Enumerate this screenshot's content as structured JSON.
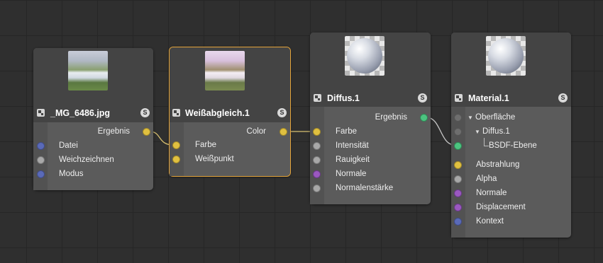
{
  "nodes": {
    "image": {
      "title": "_MG_6486.jpg",
      "badge": "S",
      "output": "Ergebnis",
      "inputs": [
        "Datei",
        "Weichzeichnen",
        "Modus"
      ]
    },
    "whitebalance": {
      "title": "Weißabgleich.1",
      "badge": "S",
      "output": "Color",
      "inputs": [
        "Farbe",
        "Weißpunkt"
      ]
    },
    "diffuse": {
      "title": "Diffus.1",
      "badge": "S",
      "output": "Ergebnis",
      "inputs": [
        "Farbe",
        "Intensität",
        "Rauigkeit",
        "Normale",
        "Normalenstärke"
      ]
    },
    "material": {
      "title": "Material.1",
      "badge": "S",
      "tree": [
        "Oberfläche",
        "Diffus.1",
        "BSDF-Ebene"
      ],
      "inputs": [
        "Abstrahlung",
        "Alpha",
        "Normale",
        "Displacement",
        "Kontext"
      ]
    }
  },
  "colors": {
    "background": "#2f2f2f",
    "selection": "#e5a53b",
    "port_color": "#e0c040",
    "port_filename": "#5a6ab8",
    "port_float": "#a8a8a8",
    "port_vector": "#9a58c0",
    "port_bsdf": "#4cc480"
  }
}
